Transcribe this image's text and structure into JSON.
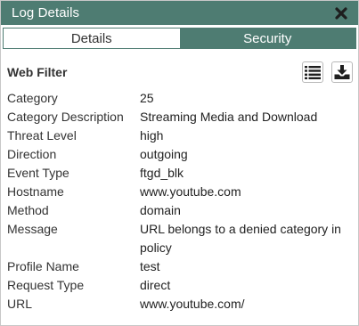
{
  "window": {
    "title": "Log Details"
  },
  "tabs": [
    {
      "label": "Details",
      "active": false
    },
    {
      "label": "Security",
      "active": true
    }
  ],
  "section": {
    "title": "Web Filter",
    "icons": [
      "list-view-icon",
      "download-icon"
    ]
  },
  "fields": [
    {
      "label": "Category",
      "value": "25"
    },
    {
      "label": "Category Description",
      "value": "Streaming Media and Download"
    },
    {
      "label": "Threat Level",
      "value": "high"
    },
    {
      "label": "Direction",
      "value": "outgoing"
    },
    {
      "label": "Event Type",
      "value": "ftgd_blk"
    },
    {
      "label": "Hostname",
      "value": "www.youtube.com"
    },
    {
      "label": "Method",
      "value": "domain"
    },
    {
      "label": "Message",
      "value": "URL belongs to a denied category in policy"
    },
    {
      "label": "Profile Name",
      "value": "test"
    },
    {
      "label": "Request Type",
      "value": "direct"
    },
    {
      "label": "URL",
      "value": "www.youtube.com/"
    }
  ],
  "colors": {
    "accent": "#4e7c72",
    "text": "#222222",
    "background": "#ffffff"
  }
}
